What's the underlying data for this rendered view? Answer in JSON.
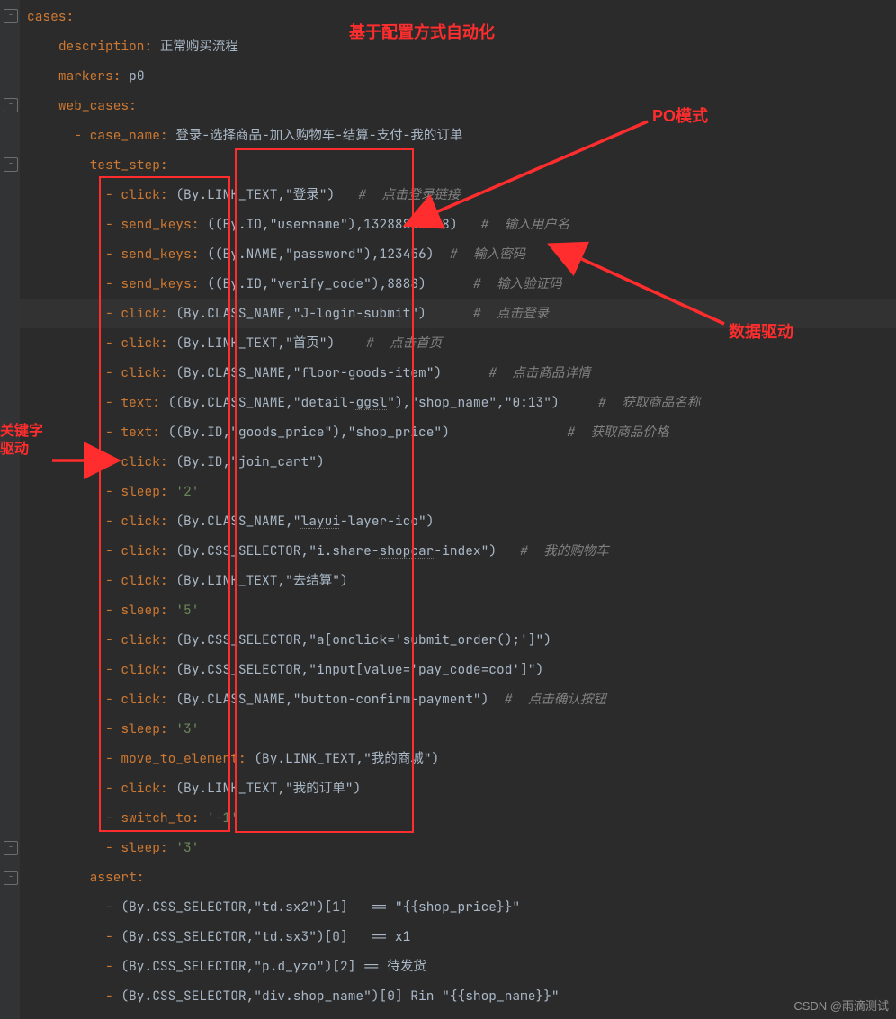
{
  "annotations": {
    "top": "基于配置方式自动化",
    "po": "PO模式",
    "data": "数据驱动",
    "keyword_l1": "关键字",
    "keyword_l2": "驱动"
  },
  "watermark": "CSDN @雨滴测试",
  "code": {
    "l01": "cases:",
    "l02_k": "description",
    "l02_v": "正常购买流程",
    "l03_k": "markers",
    "l03_v": "p0",
    "l04": "web_cases:",
    "l05_k": "case_name",
    "l05_v": "登录-选择商品-加入购物车-结算-支付-我的订单",
    "l06": "test_step:",
    "l07_action": "click",
    "l07_args": "(By.LINK_TEXT,\"登录\")",
    "l07_c": "#  点击登录链接",
    "l08_action": "send_keys",
    "l08_args": "((By.ID,\"username\"),13288888888)",
    "l08_c": "#  输入用户名",
    "l09_action": "send_keys",
    "l09_args": "((By.NAME,\"password\"),123456)",
    "l09_c": "#  输入密码",
    "l10_action": "send_keys",
    "l10_args": "((By.ID,\"verify_code\"),8888)",
    "l10_c": "#  输入验证码",
    "l11_action": "click",
    "l11_args": "(By.CLASS_NAME,\"J-login-submit\")",
    "l11_c": "#  点击登录",
    "l12_action": "click",
    "l12_args": "(By.LINK_TEXT,\"首页\")",
    "l12_c": "#  点击首页",
    "l13_action": "click",
    "l13_args": "(By.CLASS_NAME,\"floor-goods-item\")",
    "l13_c": "#  点击商品详情",
    "l14_action": "text",
    "l14_args": "((By.CLASS_NAME,\"detail-ggsl\"),\"shop_name\",\"0:13\")",
    "l14_c": "#  获取商品名称",
    "l15_action": "text",
    "l15_args": "((By.ID,\"goods_price\"),\"shop_price\")",
    "l15_c": "#  获取商品价格",
    "l16_action": "click",
    "l16_args": "(By.ID,\"join_cart\")",
    "l17_action": "sleep",
    "l17_v": "'2'",
    "l18_action": "click",
    "l18_args": "(By.CLASS_NAME,\"layui-layer-ico\")",
    "l19_action": "click",
    "l19_args": "(By.CSS_SELECTOR,\"i.share-shopcar-index\")",
    "l19_c": "#  我的购物车",
    "l20_action": "click",
    "l20_args": "(By.LINK_TEXT,\"去结算\")",
    "l21_action": "sleep",
    "l21_v": "'5'",
    "l22_action": "click",
    "l22_args": "(By.CSS_SELECTOR,\"a[onclick='submit_order();']\")",
    "l23_action": "click",
    "l23_args": "(By.CSS_SELECTOR,\"input[value='pay_code=cod']\")",
    "l24_action": "click",
    "l24_args": "(By.CLASS_NAME,\"button-confirm-payment\")",
    "l24_c": "#  点击确认按钮",
    "l25_action": "sleep",
    "l25_v": "'3'",
    "l26_action": "move_to_element",
    "l26_args": "(By.LINK_TEXT,\"我的商城\")",
    "l27_action": "click",
    "l27_args": "(By.LINK_TEXT,\"我的订单\")",
    "l28_action": "switch_to",
    "l28_v": "'-1'",
    "l29_action": "sleep",
    "l29_v": "'3'",
    "l30": "assert:",
    "l31": "(By.CSS_SELECTOR,\"td.sx2\")[1]   == \"{{shop_price}}\"",
    "l32": "(By.CSS_SELECTOR,\"td.sx3\")[0]   == x1",
    "l33": "(By.CSS_SELECTOR,\"p.d_yzo\")[2] == 待发货",
    "l34": "(By.CSS_SELECTOR,\"div.shop_name\")[0] Rin \"{{shop_name}}\""
  }
}
